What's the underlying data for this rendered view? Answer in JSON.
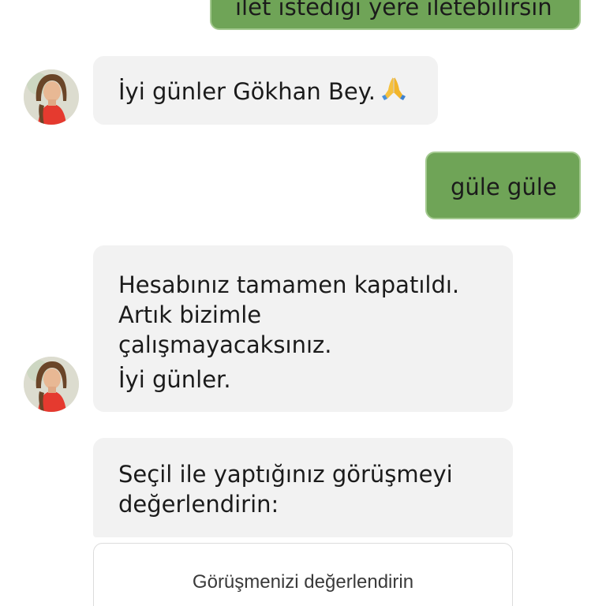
{
  "messages": {
    "m0": {
      "text": "ilet istediği yere iletebilirsin",
      "direction": "outgoing"
    },
    "m1": {
      "text": "İyi günler Gökhan Bey.",
      "emoji": "folded-hands",
      "direction": "incoming"
    },
    "m2": {
      "text": "güle güle",
      "direction": "outgoing"
    },
    "m3": {
      "lines": [
        "Hesabınız tamamen kapatıldı.",
        "Artık bizimle",
        "çalışmayacaksınız."
      ],
      "line4": "İyi günler.",
      "direction": "incoming"
    },
    "m4": {
      "lines": [
        "Seçil ile yaptığınız görüşmeyi",
        "değerlendirin:"
      ],
      "direction": "incoming"
    }
  },
  "rating": {
    "title": "Görüşmenizi değerlendirin"
  },
  "colors": {
    "outgoing_bubble": "#6fa457",
    "incoming_bubble": "#f2f2f2",
    "text": "#1b1b1b"
  }
}
